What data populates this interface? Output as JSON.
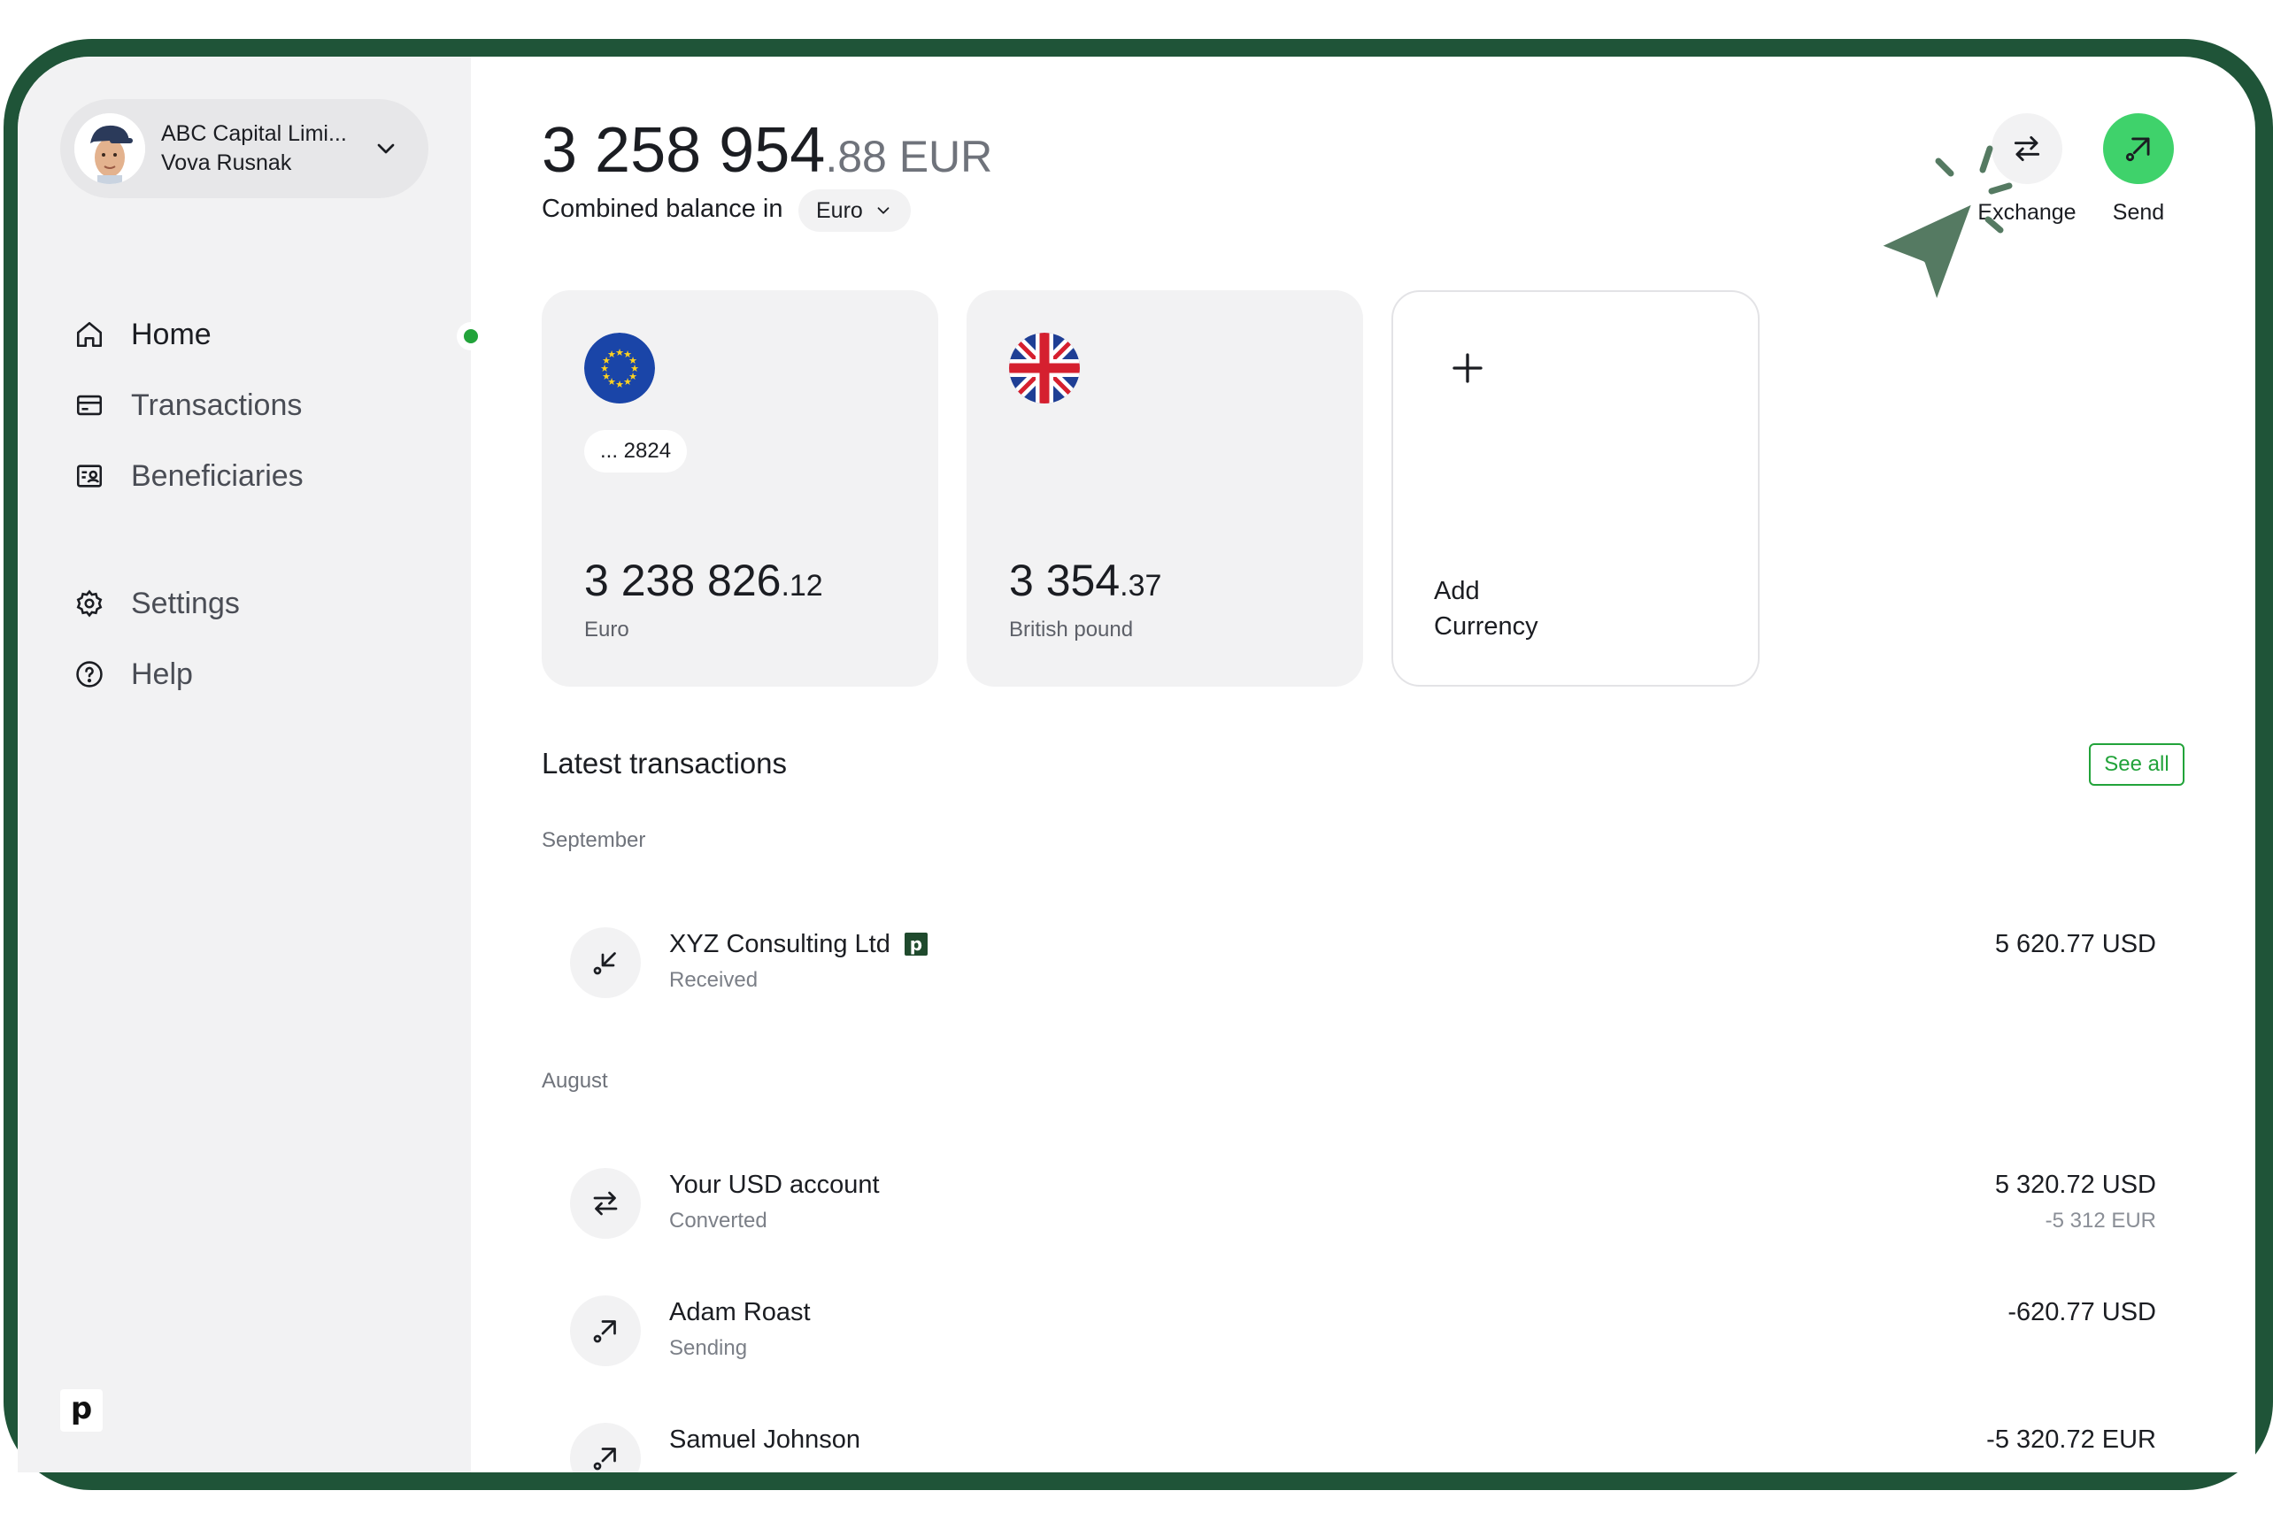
{
  "colors": {
    "frame": "#1f5438",
    "accent_green": "#22a33a",
    "send_button": "#3fd26b",
    "sidebar_bg": "#f2f2f3",
    "cursor": "#557a62"
  },
  "account": {
    "company": "ABC Capital Limi...",
    "user": "Vova Rusnak",
    "chevron_icon": "chevron-down-icon"
  },
  "nav": {
    "items": [
      {
        "label": "Home",
        "icon": "home-icon",
        "active": true
      },
      {
        "label": "Transactions",
        "icon": "card-icon",
        "active": false
      },
      {
        "label": "Beneficiaries",
        "icon": "contact-card-icon",
        "active": false
      },
      {
        "label": "Settings",
        "icon": "gear-icon",
        "active": false
      },
      {
        "label": "Help",
        "icon": "help-icon",
        "active": false
      }
    ]
  },
  "brand": {
    "logo_text": "p"
  },
  "balance": {
    "integer": "3 258 954",
    "decimal": ".88 EUR",
    "combined_label": "Combined balance in",
    "currency_select": "Euro"
  },
  "actions": {
    "exchange": "Exchange",
    "send": "Send"
  },
  "cards": [
    {
      "flag": "eu-flag-icon",
      "account_tag": "... 2824",
      "amount_int": "3 238 826",
      "amount_dec": ".12",
      "currency": "Euro"
    },
    {
      "flag": "uk-flag-icon",
      "account_tag": "",
      "amount_int": "3 354",
      "amount_dec": ".37",
      "currency": "British pound"
    }
  ],
  "add_currency": {
    "line1": "Add",
    "line2": "Currency"
  },
  "transactions": {
    "title": "Latest transactions",
    "see_all": "See all",
    "groups": [
      {
        "month": "September",
        "items": [
          {
            "name": "XYZ Consulting Ltd",
            "status": "Received",
            "amount": "5 620.77 USD",
            "sub_amount": "",
            "badge": "p",
            "icon": "arrow-down-left-icon"
          }
        ]
      },
      {
        "month": "August",
        "items": [
          {
            "name": "Your USD account",
            "status": "Converted",
            "amount": "5 320.72 USD",
            "sub_amount": "-5 312 EUR",
            "icon": "exchange-icon"
          },
          {
            "name": "Adam Roast",
            "status": "Sending",
            "amount": "-620.77 USD",
            "sub_amount": "",
            "icon": "arrow-up-right-icon"
          },
          {
            "name": "Samuel Johnson",
            "status": "",
            "amount": "-5 320.72 EUR",
            "sub_amount": "",
            "icon": "arrow-up-right-icon"
          }
        ]
      }
    ]
  }
}
